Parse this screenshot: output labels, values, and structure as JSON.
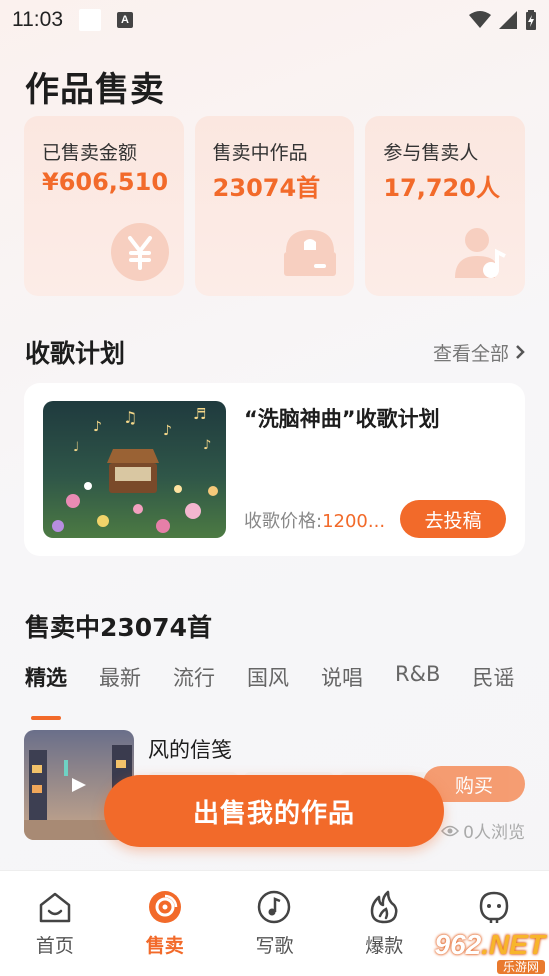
{
  "status_bar": {
    "time": "11:03",
    "a_icon": "A"
  },
  "page_title": "作品售卖",
  "stats": [
    {
      "label": "已售卖金额",
      "value": "¥606,510",
      "icon": "yen-icon"
    },
    {
      "label": "售卖中作品",
      "value": "23074首",
      "icon": "music-box-icon"
    },
    {
      "label": "参与售卖人",
      "value": "17,720人",
      "icon": "person-music-icon"
    }
  ],
  "collect_section": {
    "title": "收歌计划",
    "see_all": "查看全部"
  },
  "plan": {
    "title": "“洗脑神曲”收歌计划",
    "price_label": "收歌价格:",
    "price_value": "1200...",
    "submit_label": "去投稿"
  },
  "selling": {
    "title": "售卖中23074首",
    "tabs": [
      "精选",
      "最新",
      "流行",
      "国风",
      "说唱",
      "R&B",
      "民谣"
    ],
    "active_tab": "精选"
  },
  "song": {
    "title": "风的信笺",
    "buy_label": "购买",
    "views": "0人浏览"
  },
  "cta": {
    "label": "出售我的作品"
  },
  "bottom_nav": [
    {
      "label": "首页",
      "icon": "home-icon"
    },
    {
      "label": "售卖",
      "icon": "sell-icon"
    },
    {
      "label": "写歌",
      "icon": "write-song-icon"
    },
    {
      "label": "爆款",
      "icon": "fire-icon"
    },
    {
      "label": "",
      "icon": "profile-icon"
    }
  ],
  "watermark": {
    "number": "962",
    "suffix": ".NET",
    "sub": "乐游网"
  },
  "colors": {
    "accent": "#f26a2a",
    "card_bg": "#fbe7e0"
  }
}
